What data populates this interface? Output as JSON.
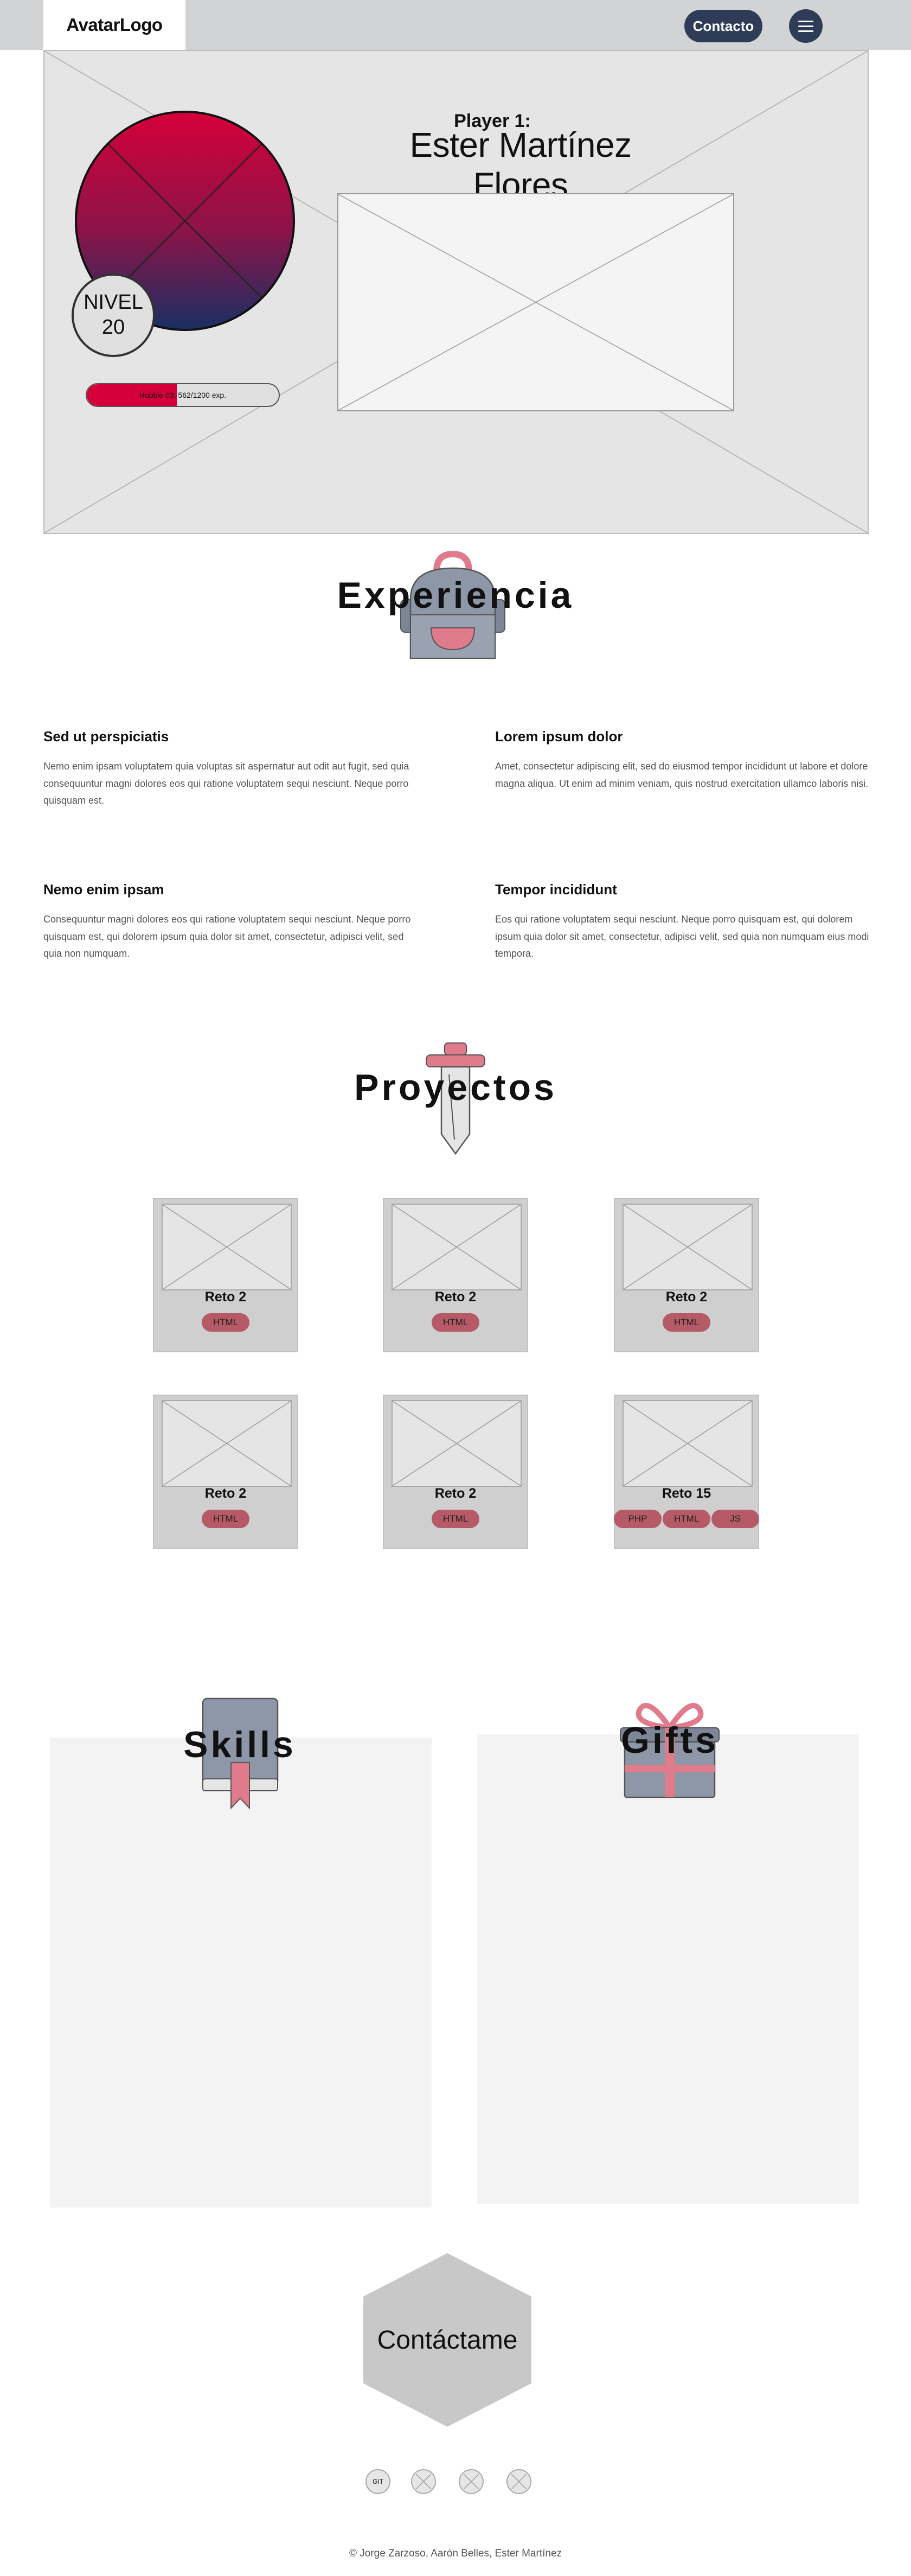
{
  "header": {
    "logo": "AvatarLogo",
    "contact_label": "Contacto"
  },
  "hero": {
    "player_label": "Player 1:",
    "player_name": "Ester Martínez Flores",
    "level_label": "NIVEL",
    "level_value": "20",
    "xp_text": "Hobbie 03: 562/1200 exp.",
    "xp_progress": 0.47,
    "avatar_gradient": [
      "#d5003a",
      "#8a1448",
      "#1b2f63"
    ]
  },
  "experience": {
    "title": "Experiencia",
    "icon": "backpack-icon",
    "items": [
      {
        "heading": "Sed ut perspiciatis",
        "text": "Nemo enim ipsam voluptatem quia voluptas sit aspernatur aut odit aut fugit, sed quia consequuntur magni dolores eos qui ratione voluptatem sequi nesciunt. Neque porro quisquam est."
      },
      {
        "heading": "Lorem ipsum dolor",
        "text": "Amet, consectetur adipiscing elit, sed do eiusmod tempor incididunt ut labore et dolore magna aliqua. Ut enim ad minim veniam, quis nostrud exercitation ullamco laboris nisi."
      },
      {
        "heading": "Nemo enim ipsam",
        "text": "Consequuntur magni dolores eos qui ratione voluptatem sequi nesciunt. Neque porro quisquam est, qui dolorem ipsum quia dolor sit amet, consectetur, adipisci velit, sed quia non numquam."
      },
      {
        "heading": "Tempor incididunt",
        "text": "Eos qui ratione voluptatem sequi nesciunt. Neque porro quisquam est, qui dolorem ipsum quia dolor sit amet, consectetur, adipisci velit, sed quia non numquam eius modi tempora."
      }
    ]
  },
  "projects": {
    "title": "Proyectos",
    "icon": "sword-icon",
    "cards": [
      {
        "title": "Reto 2",
        "tags": [
          "HTML"
        ]
      },
      {
        "title": "Reto 2",
        "tags": [
          "HTML"
        ]
      },
      {
        "title": "Reto 2",
        "tags": [
          "HTML"
        ]
      },
      {
        "title": "Reto 2",
        "tags": [
          "HTML"
        ]
      },
      {
        "title": "Reto 2",
        "tags": [
          "HTML"
        ]
      },
      {
        "title": "Reto 15",
        "tags": [
          "PHP",
          "HTML",
          "JS"
        ]
      }
    ]
  },
  "skills": {
    "title": "Skills",
    "icon": "book-bookmark-icon"
  },
  "gifts": {
    "title": "Gifts",
    "icon": "gift-box-icon"
  },
  "contact": {
    "label": "Contáctame"
  },
  "social": {
    "items": [
      "GIT",
      "",
      "",
      ""
    ]
  },
  "footer": {
    "text": "© Jorge Zarzoso, Aarón Belles, Ester Martínez"
  },
  "colors": {
    "header_bg": "#d1d3d4",
    "accent_dark": "#2f3c57",
    "accent_red": "#d5003a",
    "tag_bg": "#b55a66",
    "icon_pink": "#e07b8c",
    "icon_grey": "#8e97a8"
  }
}
